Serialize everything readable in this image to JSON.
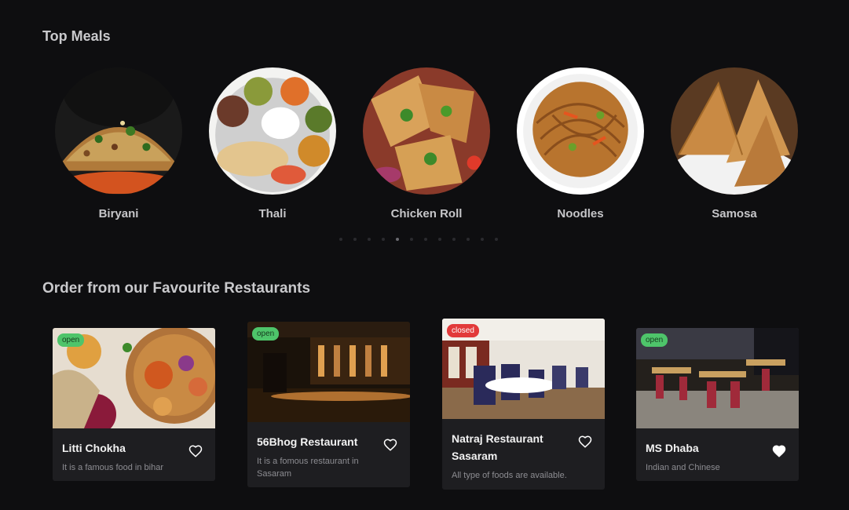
{
  "sections": {
    "top_meals_title": "Top Meals",
    "restaurants_title": "Order from our Favourite Restaurants"
  },
  "meals": [
    {
      "label": "Biryani"
    },
    {
      "label": "Thali"
    },
    {
      "label": "Chicken Roll"
    },
    {
      "label": "Noodles"
    },
    {
      "label": "Samosa"
    }
  ],
  "carousel": {
    "dot_count": 12,
    "active_index": 4
  },
  "restaurants": [
    {
      "name": "Litti Chokha",
      "description": "It is a famous food in bihar",
      "status": "open",
      "favorite": false
    },
    {
      "name": "56Bhog Restaurant",
      "description": "It is a fomous restaurant in Sasaram",
      "status": "open",
      "favorite": false
    },
    {
      "name": "Natraj Restaurant Sasaram",
      "description": "All type of foods are available.",
      "status": "closed",
      "favorite": false
    },
    {
      "name": "MS Dhaba",
      "description": "Indian and Chinese",
      "status": "open",
      "favorite": true
    }
  ],
  "colors": {
    "background": "#0e0e10",
    "card": "#1e1e21",
    "open_badge": "#4ec46a",
    "closed_badge": "#e23a3a"
  }
}
